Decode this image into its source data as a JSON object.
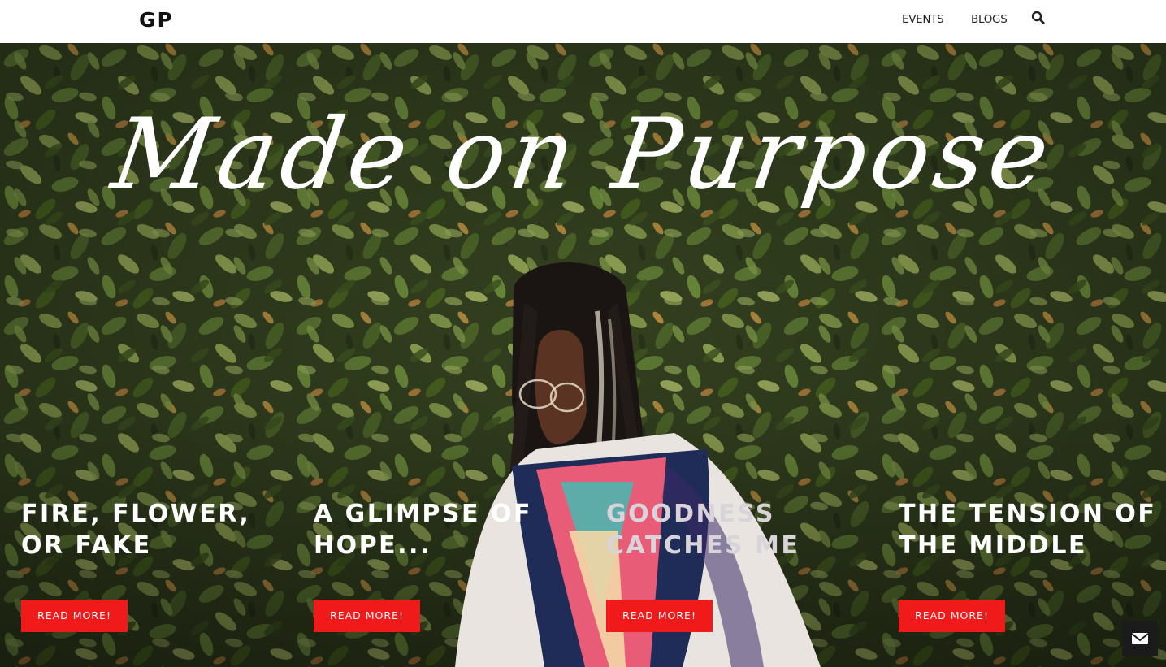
{
  "header": {
    "logo": "GP",
    "nav": [
      {
        "label": "EVENTS"
      },
      {
        "label": "BLOGS"
      }
    ],
    "search_icon": "search-icon"
  },
  "hero": {
    "title": "Made on Purpose"
  },
  "posts": [
    {
      "title": "FIRE, FLOWER, OR FAKE",
      "button": "READ MORE!"
    },
    {
      "title": "A GLIMPSE OF HOPE...",
      "button": "READ MORE!"
    },
    {
      "title": "GOODNESS CATCHES ME",
      "button": "READ MORE!"
    },
    {
      "title": "THE TENSION OF THE MIDDLE",
      "button": "READ MORE!"
    }
  ],
  "contact_button": {
    "icon": "envelope-icon"
  },
  "colors": {
    "button_red": "#f01a1a",
    "foliage_dark": "#34421f",
    "header_bg": "#ffffff",
    "contact_bg": "#1b1b1b"
  }
}
